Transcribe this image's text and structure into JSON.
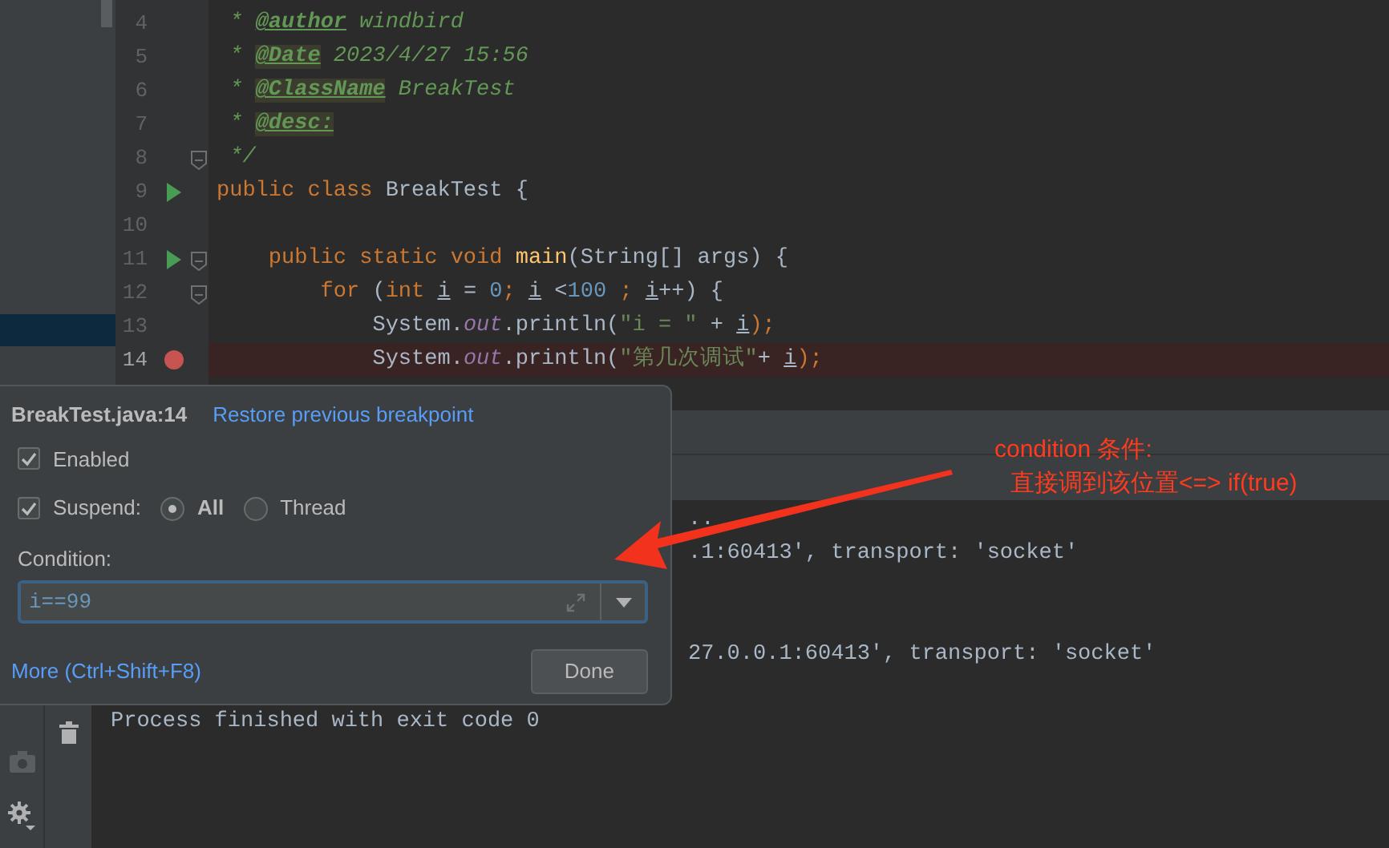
{
  "editor": {
    "lines": [
      {
        "number": "4",
        "kind": "plain",
        "fold": false,
        "tokens": [
          {
            "t": " * ",
            "kind": "doc"
          },
          {
            "t": "@author",
            "kind": "doctag"
          },
          {
            "t": " windbird",
            "kind": "doc"
          }
        ]
      },
      {
        "number": "5",
        "kind": "plain",
        "fold": false,
        "tokens": [
          {
            "t": " * ",
            "kind": "doc"
          },
          {
            "t": "@Date",
            "kind": "doctag_hl"
          },
          {
            "t": " 2023/4/27 15:56",
            "kind": "doc"
          }
        ]
      },
      {
        "number": "6",
        "kind": "plain",
        "fold": false,
        "tokens": [
          {
            "t": " * ",
            "kind": "doc"
          },
          {
            "t": "@ClassName",
            "kind": "doctag_hl"
          },
          {
            "t": " BreakTest",
            "kind": "doc"
          }
        ]
      },
      {
        "number": "7",
        "kind": "plain",
        "fold": false,
        "tokens": [
          {
            "t": " * ",
            "kind": "doc"
          },
          {
            "t": "@desc:",
            "kind": "doctag_hl"
          }
        ]
      },
      {
        "number": "8",
        "kind": "plain",
        "fold": true,
        "tokens": [
          {
            "t": " */",
            "kind": "doc"
          }
        ]
      },
      {
        "number": "9",
        "kind": "run",
        "fold": false,
        "tokens": [
          {
            "t": "public class ",
            "kind": "kw"
          },
          {
            "t": "BreakTest {",
            "kind": "plain"
          }
        ]
      },
      {
        "number": "10",
        "kind": "plain",
        "fold": false
      },
      {
        "number": "11",
        "kind": "run",
        "fold": true,
        "tokens": [
          {
            "t": "    public static void ",
            "kind": "kw"
          },
          {
            "t": "main",
            "kind": "method"
          },
          {
            "t": "(String[] args) {",
            "kind": "plain"
          }
        ]
      },
      {
        "number": "12",
        "kind": "plain",
        "fold": true,
        "tokens": [
          {
            "t": "        for ",
            "kind": "kw"
          },
          {
            "t": "(",
            "kind": "plain"
          },
          {
            "t": "int ",
            "kind": "kw"
          },
          {
            "t": "i",
            "kind": "local"
          },
          {
            "t": " = ",
            "kind": "plain"
          },
          {
            "t": "0",
            "kind": "num"
          },
          {
            "t": "; ",
            "kind": "kw"
          },
          {
            "t": "i",
            "kind": "local"
          },
          {
            "t": " <",
            "kind": "plain"
          },
          {
            "t": "100",
            "kind": "num"
          },
          {
            "t": " ; ",
            "kind": "kw"
          },
          {
            "t": "i",
            "kind": "local"
          },
          {
            "t": "++) {",
            "kind": "plain"
          }
        ]
      },
      {
        "number": "13",
        "kind": "plain",
        "fold": false,
        "tokens": [
          {
            "t": "            System.",
            "kind": "plain"
          },
          {
            "t": "out",
            "kind": "static"
          },
          {
            "t": ".println(",
            "kind": "plain"
          },
          {
            "t": "\"i = \"",
            "kind": "str"
          },
          {
            "t": " + ",
            "kind": "plain"
          },
          {
            "t": "i",
            "kind": "local"
          },
          {
            "t": ");",
            "kind": "kw"
          }
        ]
      },
      {
        "number": "14",
        "kind": "breakpoint",
        "fold": false,
        "tokens": [
          {
            "t": "            System.",
            "kind": "plain"
          },
          {
            "t": "out",
            "kind": "static"
          },
          {
            "t": ".println(",
            "kind": "plain"
          },
          {
            "t": "\"第几次调试\"",
            "kind": "str"
          },
          {
            "t": "+ ",
            "kind": "plain"
          },
          {
            "t": "i",
            "kind": "local"
          },
          {
            "t": ");",
            "kind": "kw"
          }
        ]
      }
    ]
  },
  "console": {
    "lines": [
      {
        "kind": "partial",
        "text": ".."
      },
      {
        "kind": "partial",
        "text": ".1:60413', transport: 'socket'"
      },
      {
        "kind": "blank"
      },
      {
        "kind": "blank"
      },
      {
        "kind": "partial",
        "text": "27.0.0.1:60413', transport: 'socket'"
      },
      {
        "kind": "blank"
      },
      {
        "kind": "full",
        "text": "Process finished with exit code 0"
      }
    ]
  },
  "popup": {
    "title": "BreakTest.java:14",
    "restore_link": "Restore previous breakpoint",
    "enabled": {
      "label": "Enabled",
      "checked": true
    },
    "suspend": {
      "label": "Suspend:",
      "checked": true,
      "options": [
        {
          "label": "All",
          "selected": true
        },
        {
          "label": "Thread",
          "selected": false
        }
      ]
    },
    "condition": {
      "label": "Condition:",
      "value": "i==99"
    },
    "more_link": "More (Ctrl+Shift+F8)",
    "done_button": "Done"
  },
  "annotation": {
    "lines": [
      "condition 条件:",
      "直接调到该位置<=> if(true)"
    ]
  }
}
